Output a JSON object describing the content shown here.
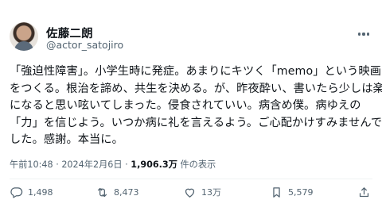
{
  "author": {
    "name": "佐藤二朗",
    "handle": "@actor_satojiro"
  },
  "post": {
    "lines": [
      "「強迫性障害」。小学生時に発症。あまりにキツく「memo」という映画",
      "をつくる。根治を諦め、共生を決める。が、昨夜酔い、書いたら少しは楽",
      "になると思い呟いてしまった。侵食されていい。病含め僕。病ゆえの",
      "「力」を信じよう。いつか病に礼を言えるよう。ご心配かけすみませんで",
      "した。感謝。本当に。"
    ]
  },
  "meta": {
    "time": "午前10:48",
    "separator": "·",
    "date": "2024年2月6日",
    "views": "1,906.3万",
    "views_suffix": "件の表示"
  },
  "actions": {
    "replies": "1,498",
    "reposts": "8,473",
    "likes": "13万",
    "bookmarks": "5,579"
  },
  "icons": {
    "more": "more-dots-icon",
    "reply": "reply-bubble-icon",
    "repost": "repost-arrows-icon",
    "like": "heart-icon",
    "bookmark": "bookmark-icon",
    "share": "share-upload-icon"
  }
}
